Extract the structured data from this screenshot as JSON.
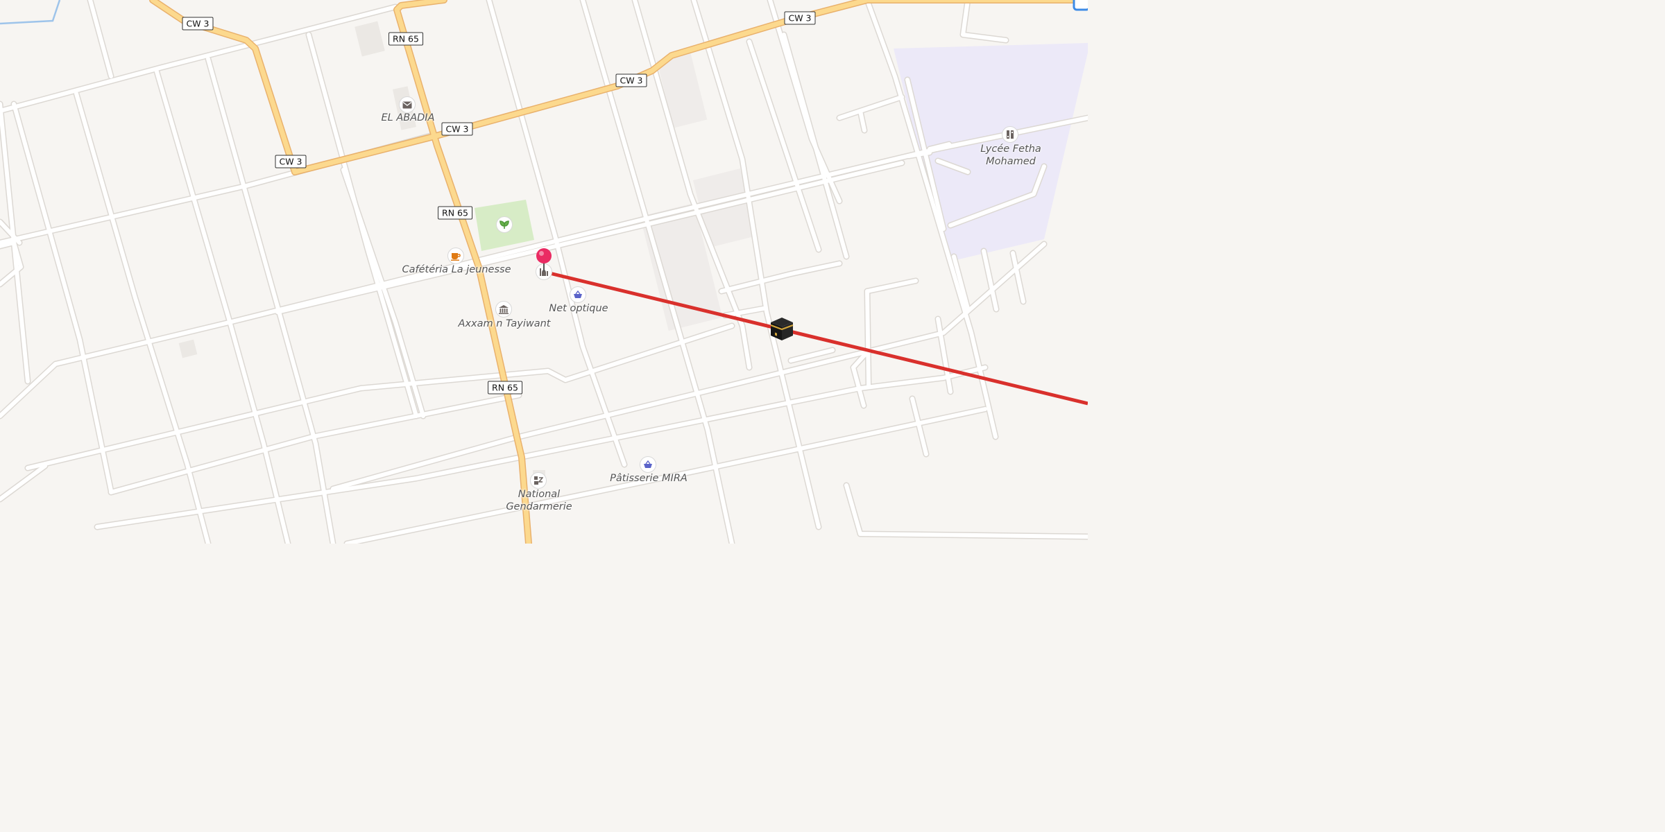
{
  "road_shields": {
    "cw3_a": "CW 3",
    "cw3_b": "CW 3",
    "cw3_c": "CW 3",
    "cw3_d": "CW 3",
    "cw3_e": "CW 3",
    "rn65_a": "RN 65",
    "rn65_b": "RN 65",
    "rn65_c": "RN 65"
  },
  "pois": {
    "el_abadia": "EL ABADIA",
    "cafeteria": "Cafétéria La jeunesse",
    "net_optique": "Net optique",
    "axxam": "Axxam n Tayiwant",
    "lycee": "Lycée Fetha Mohamed",
    "patisserie": "Pâtisserie MIRA",
    "gendarmerie": "National Gendarmerie"
  },
  "icons": {
    "post": "envelope-icon",
    "garden": "leaf-icon",
    "cafe": "coffee-cup-icon",
    "mosque": "mosque-icon",
    "optician": "basket-icon",
    "museum": "museum-icon",
    "school": "school-icon",
    "bakery": "basket-icon",
    "police": "police-icon",
    "kaaba": "kaaba-icon",
    "pin": "location-pin-icon"
  },
  "colors": {
    "background": "#f7f5f2",
    "street": "#ffffff",
    "street_casing": "#dedad5",
    "main_road": "#fcd98e",
    "main_road_casing": "#e9b16c",
    "park": "#d7ecc6",
    "school_area": "#ece9f8",
    "qibla_line": "#d9302c",
    "pin": "#ea2b63"
  }
}
